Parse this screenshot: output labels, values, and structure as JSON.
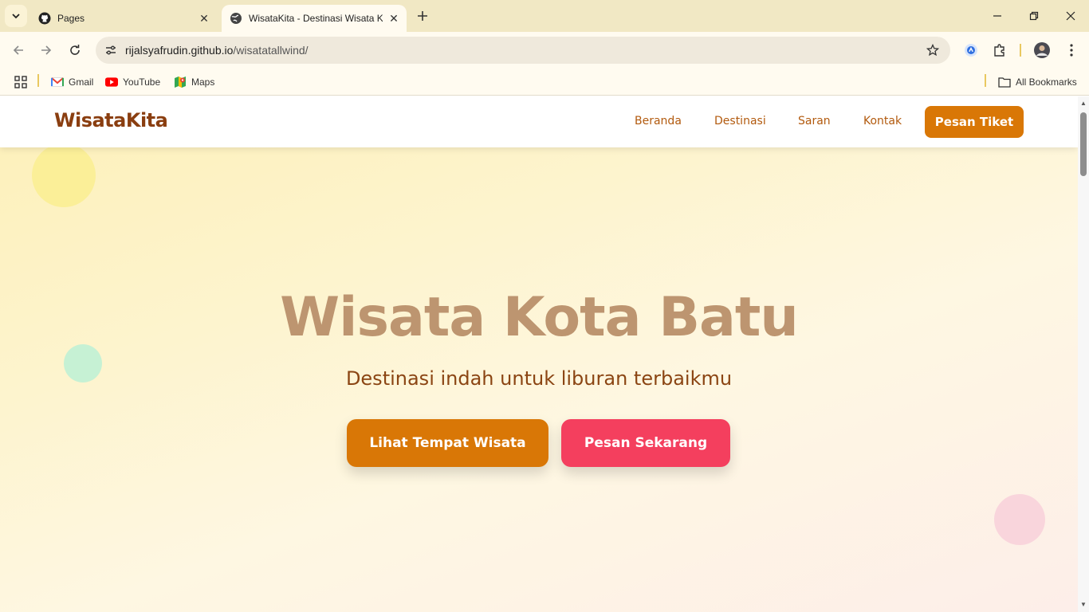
{
  "browser": {
    "tabs": [
      {
        "title": "Pages",
        "active": false
      },
      {
        "title": "WisataKita - Destinasi Wisata Kota Batu",
        "active": true
      }
    ],
    "address": {
      "host": "rijalsyafrudin.github.io",
      "path": "/wisatatallwind/"
    },
    "bookmarks": [
      {
        "label": "Gmail"
      },
      {
        "label": "YouTube"
      },
      {
        "label": "Maps"
      }
    ],
    "all_bookmarks_label": "All Bookmarks"
  },
  "site": {
    "brand": "WisataKita",
    "nav": [
      "Beranda",
      "Destinasi",
      "Saran",
      "Kontak"
    ],
    "nav_cta": "Pesan Tiket"
  },
  "hero": {
    "title": "Wisata Kota Batu",
    "subtitle": "Destinasi indah untuk liburan terbaikmu",
    "primary_button": "Lihat Tempat Wisata",
    "secondary_button": "Pesan Sekarang"
  },
  "colors": {
    "brand": "#8a3e10",
    "accent": "#d97706",
    "secondary": "#f43f5e",
    "hero_title": "#bd9570"
  }
}
